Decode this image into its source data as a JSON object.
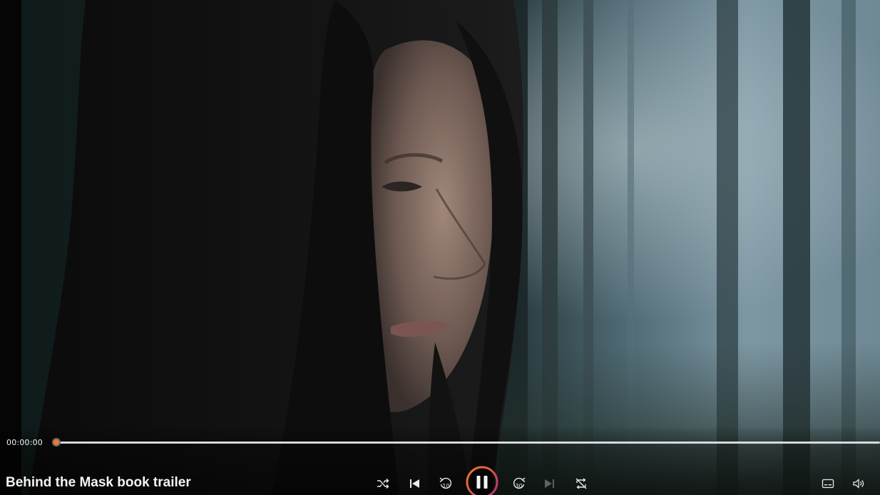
{
  "player": {
    "title": "Behind the Mask book trailer",
    "time_current": "00:00:00",
    "progress": 0,
    "state": "playing"
  },
  "controls": {
    "shuffle_icon": "shuffle-icon",
    "previous_icon": "previous-icon",
    "rewind_icon": "rewind-10-icon",
    "rewind_label": "10",
    "play_pause_icon": "pause-icon",
    "forward_icon": "forward-30-icon",
    "forward_label": "30",
    "next_icon": "next-icon",
    "repeat_icon": "repeat-off-icon",
    "captions_icon": "captions-icon",
    "volume_icon": "volume-icon"
  },
  "colors": {
    "accent": "#f07a2a",
    "accent_ring_end": "#b0306a",
    "track": "#d9d9d9",
    "text": "#f4f4f4"
  }
}
